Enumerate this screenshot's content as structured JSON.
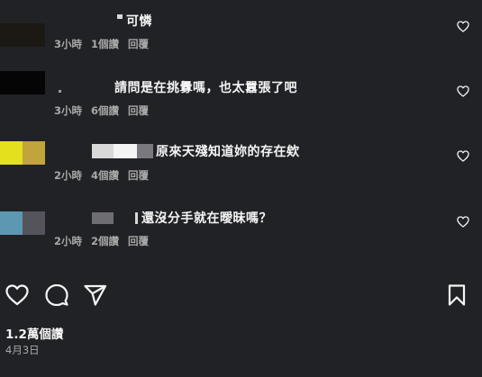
{
  "comments": [
    {
      "text": "可憐",
      "time": "3小時",
      "likes": "1個讚",
      "reply": "回覆",
      "avatar_colors": [
        "#1c1814",
        "#1c1814"
      ]
    },
    {
      "text": "請問是在挑釁嗎，也太囂張了吧",
      "time": "3小時",
      "likes": "6個讚",
      "reply": "回覆",
      "avatar_colors": [
        "#050505",
        "#050505"
      ]
    },
    {
      "text": "原來天殘知道妳的存在欸",
      "time": "2小時",
      "likes": "4個讚",
      "reply": "回覆",
      "avatar_colors": [
        "#e4e01e",
        "#c2a43c"
      ]
    },
    {
      "text": "還沒分手就在曖昧嗎？",
      "time": "2小時",
      "likes": "2個讚",
      "reply": "回覆",
      "avatar_colors": [
        "#5d98b2",
        "#55545c"
      ]
    }
  ],
  "icons": {
    "like": "heart-icon",
    "comment": "comment-icon",
    "share": "share-icon",
    "save": "bookmark-icon"
  },
  "post": {
    "likes_count": "1.2萬個讚",
    "date": "4月3日"
  }
}
